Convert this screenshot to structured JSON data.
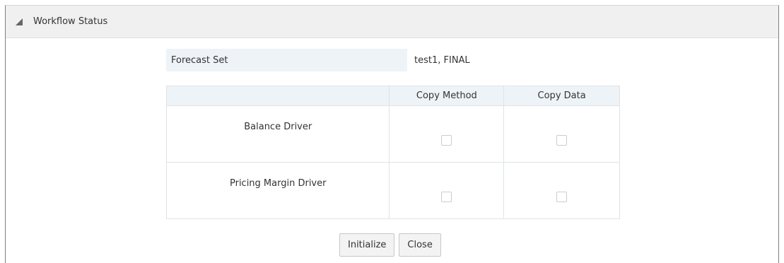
{
  "panel": {
    "title": "Workflow Status",
    "collapse_icon": "triangle-collapse-icon"
  },
  "forecast": {
    "label": "Forecast Set",
    "value": "test1, FINAL"
  },
  "grid": {
    "columns": [
      "",
      "Copy Method",
      "Copy Data"
    ],
    "rows": [
      {
        "label": "Balance Driver",
        "copy_method": false,
        "copy_data": false
      },
      {
        "label": "Pricing Margin Driver",
        "copy_method": false,
        "copy_data": false
      }
    ]
  },
  "actions": {
    "initialize_label": "Initialize",
    "close_label": "Close"
  },
  "colors": {
    "header_bg": "#f0f0f0",
    "label_bg": "#eef3f7",
    "border": "#dfe3e8"
  }
}
